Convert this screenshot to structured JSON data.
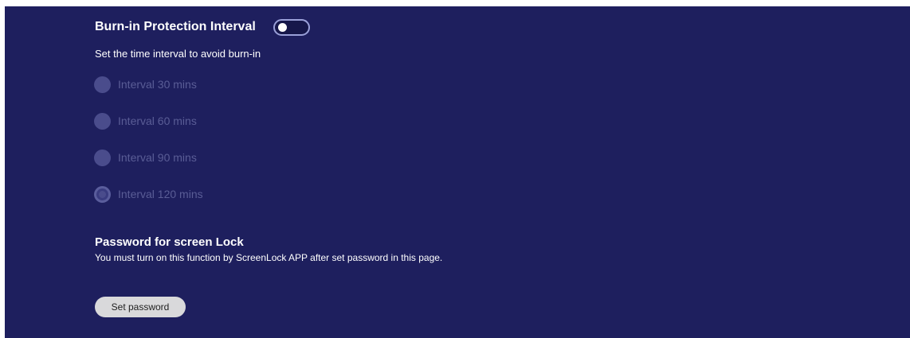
{
  "burn_in": {
    "title": "Burn-in Protection Interval",
    "toggle_on": false,
    "subtitle": "Set the time interval to avoid burn-in",
    "options": [
      {
        "label": "Interval 30 mins",
        "selected": false
      },
      {
        "label": "Interval 60 mins",
        "selected": false
      },
      {
        "label": "Interval 90 mins",
        "selected": false
      },
      {
        "label": "Interval 120 mins",
        "selected": true
      }
    ]
  },
  "password": {
    "title": "Password for screen Lock",
    "description": "You must turn on this function by ScreenLock APP after set password in this page.",
    "button_label": "Set password"
  },
  "colors": {
    "background": "#1e1f5e",
    "disabled_text": "#5a5d96",
    "button": "#d9d9db"
  }
}
